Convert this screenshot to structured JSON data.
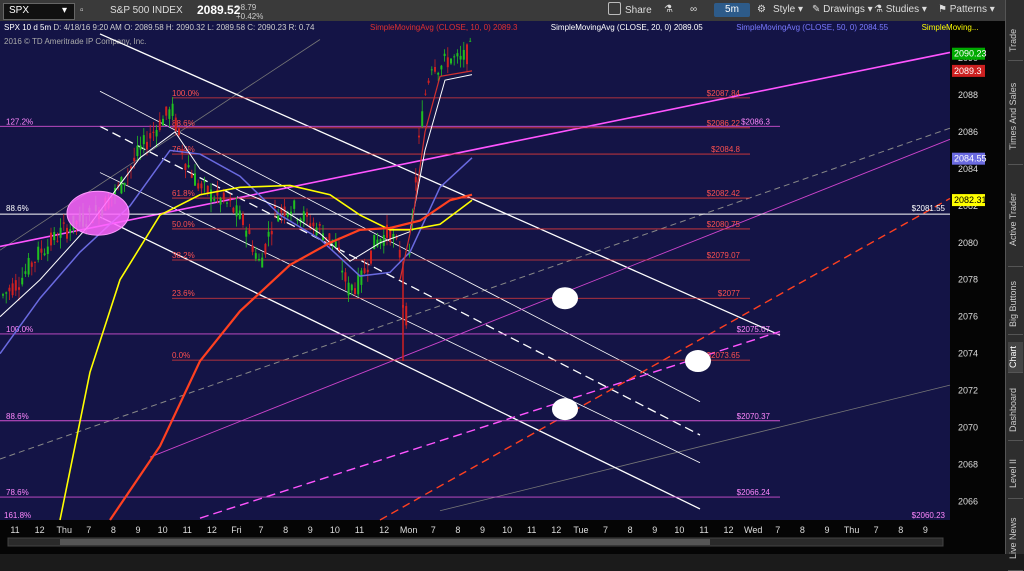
{
  "toolbar": {
    "symbol": "SPX",
    "index_name": "S&P 500 INDEX",
    "price": "2089.52",
    "change": "+8.79",
    "change_pct": "+0.42%",
    "share": "Share",
    "timeframe": "5m",
    "style": "Style",
    "drawings": "Drawings",
    "studies": "Studies",
    "patterns": "Patterns"
  },
  "sidebar": {
    "tabs": [
      "Trade",
      "Times And Sales",
      "Active Trader",
      "Big Buttons",
      "Chart",
      "Dashboard",
      "Level II",
      "Live News"
    ]
  },
  "chart_data": {
    "type": "line",
    "title": "SPX 10 d 5m",
    "ohlc_label": "D: 4/18/16 9:20 AM   O: 2089.58   H: 2090.32   L: 2089.58   C: 2090.23   R: 0.74",
    "ma_labels": [
      {
        "name": "SimpleMovingAvg (CLOSE, 10, 0)",
        "value": "2089.3",
        "color": "#e03030"
      },
      {
        "name": "SimpleMovingAvg (CLOSE, 20, 0)",
        "value": "2089.05",
        "color": "#ffffff"
      },
      {
        "name": "SimpleMovingAvg (CLOSE, 50, 0)",
        "value": "2084.55",
        "color": "#7a7aff"
      },
      {
        "name": "SimpleMoving...",
        "value": "",
        "color": "#ffff00"
      }
    ],
    "copyright": "2016 © TD Ameritrade IP Company, Inc.",
    "ylim": [
      2065,
      2092
    ],
    "y_ticks": [
      2066,
      2068,
      2070,
      2072,
      2074,
      2076,
      2078,
      2080,
      2082,
      2084,
      2086,
      2088,
      2090
    ],
    "x_ticks": [
      "11",
      "12",
      "Thu",
      "7",
      "8",
      "9",
      "10",
      "11",
      "12",
      "Fri",
      "7",
      "8",
      "9",
      "10",
      "11",
      "12",
      "Mon",
      "7",
      "8",
      "9",
      "10",
      "11",
      "12",
      "Tue",
      "7",
      "8",
      "9",
      "10",
      "11",
      "12",
      "Wed",
      "7",
      "8",
      "9",
      "Thu",
      "7",
      "8",
      "9"
    ],
    "price_badges": [
      {
        "value": "2090.23",
        "price": 2090.23,
        "bg": "#00aa00",
        "fg": "#ffffff"
      },
      {
        "value": "2089.3",
        "price": 2089.3,
        "bg": "#cc2020",
        "fg": "#ffffff"
      },
      {
        "value": "2084.55",
        "price": 2084.55,
        "bg": "#6a6ae0",
        "fg": "#ffffff"
      },
      {
        "value": "2082.31",
        "price": 2082.31,
        "bg": "#ffff00",
        "fg": "#000000"
      }
    ],
    "fib_red": [
      {
        "pct": "100.0%",
        "price": 2087.84,
        "label": "$2087.84"
      },
      {
        "pct": "88.6%",
        "price": 2086.22,
        "label": "$2086.22"
      },
      {
        "pct": "76.4%",
        "price": 2084.8,
        "label": "$2084.8"
      },
      {
        "pct": "61.8%",
        "price": 2082.42,
        "label": "$2082.42"
      },
      {
        "pct": "50.0%",
        "price": 2080.75,
        "label": "$2080.75"
      },
      {
        "pct": "38.2%",
        "price": 2079.07,
        "label": "$2079.07"
      },
      {
        "pct": "23.6%",
        "price": 2077,
        "label": "$2077"
      },
      {
        "pct": "0.0%",
        "price": 2073.65,
        "label": "$2073.65"
      }
    ],
    "fib_magenta": [
      {
        "pct": "127.2%",
        "price": 2086.3,
        "label": "$2086.3"
      },
      {
        "pct": "100.0%",
        "price": 2075.07,
        "label": "$2075.07"
      },
      {
        "pct": "88.6%",
        "price": 2070.37,
        "label": "$2070.37"
      },
      {
        "pct": "78.6%",
        "price": 2066.24,
        "label": "$2066.24"
      },
      {
        "pct": "161.8%",
        "price": 2060.23,
        "label": "$2060.23"
      }
    ],
    "hline_white": {
      "pct": "88.6%",
      "price": 2081.55,
      "label": "$2081.55"
    }
  }
}
